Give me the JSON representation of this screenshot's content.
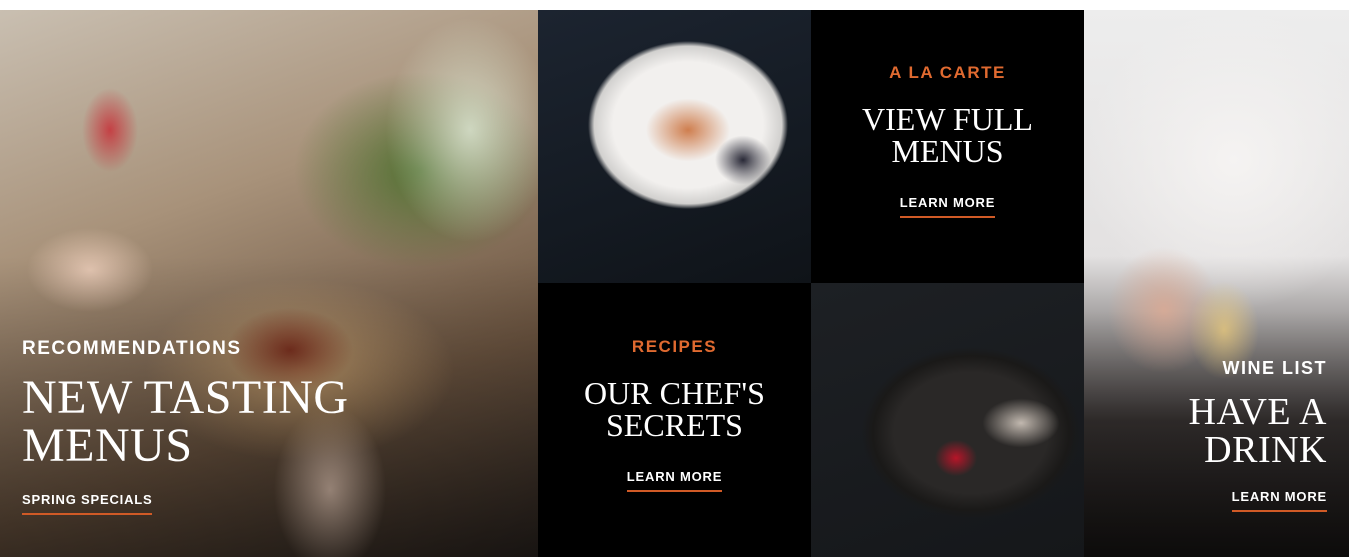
{
  "tiles": {
    "recommendations": {
      "kicker": "RECOMMENDATIONS",
      "title_line1": "NEW TASTING",
      "title_line2": "MENUS",
      "link": "SPRING SPECIALS"
    },
    "a_la_carte": {
      "kicker": "A LA CARTE",
      "title_line1": "VIEW FULL",
      "title_line2": "MENUS",
      "link": "LEARN MORE"
    },
    "recipes": {
      "kicker": "RECIPES",
      "title_line1": "OUR CHEF'S",
      "title_line2": "SECRETS",
      "link": "LEARN MORE"
    },
    "wine_list": {
      "kicker": "WINE LIST",
      "title_line1": "HAVE A",
      "title_line2": "DRINK",
      "link": "LEARN MORE"
    }
  },
  "colors": {
    "accent": "#e06a30",
    "underline": "#d05a26",
    "tile_black": "#000000",
    "text_white": "#ffffff"
  }
}
